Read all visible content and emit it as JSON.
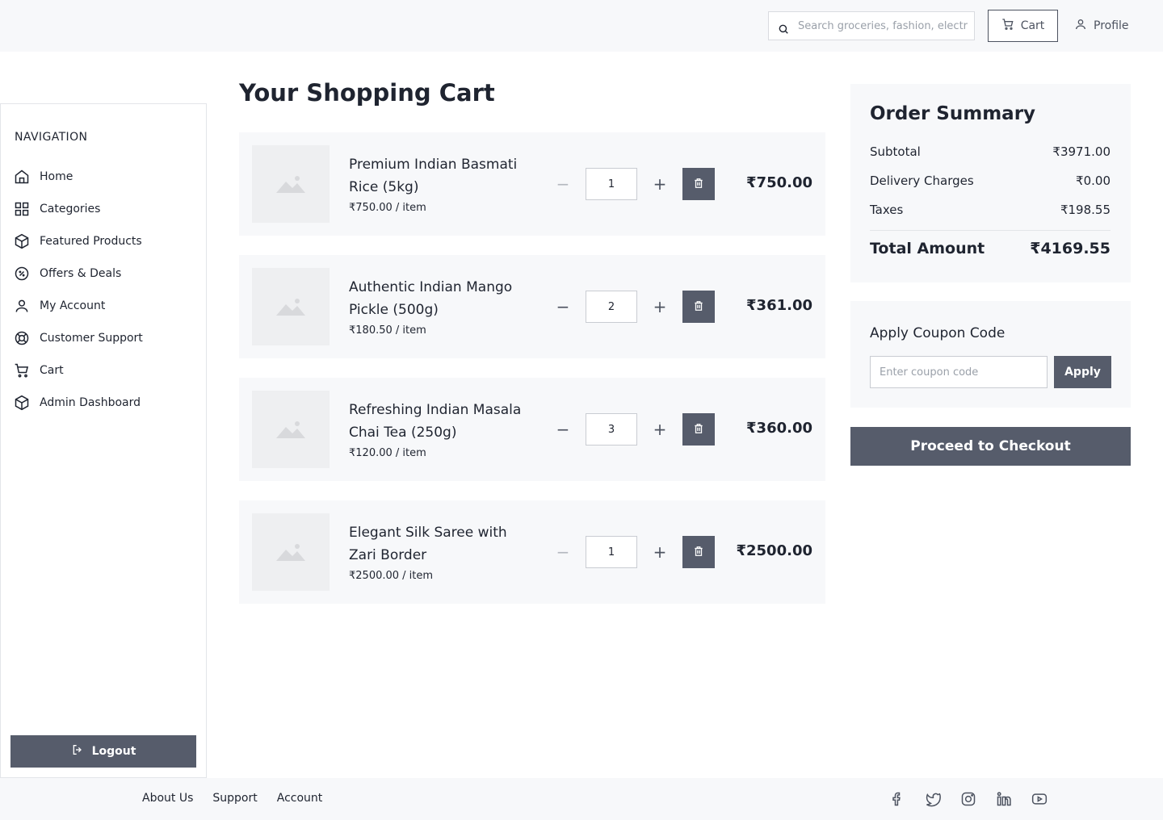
{
  "header": {
    "search_placeholder": "Search groceries, fashion, electronics...",
    "cart_label": "Cart",
    "profile_label": "Profile"
  },
  "sidebar": {
    "heading": "NAVIGATION",
    "items": [
      {
        "label": "Home",
        "icon": "home-icon"
      },
      {
        "label": "Categories",
        "icon": "grid-icon"
      },
      {
        "label": "Featured Products",
        "icon": "box-icon"
      },
      {
        "label": "Offers & Deals",
        "icon": "percent-icon"
      },
      {
        "label": "My Account",
        "icon": "user-icon"
      },
      {
        "label": "Customer Support",
        "icon": "lifebuoy-icon"
      },
      {
        "label": "Cart",
        "icon": "cart-icon"
      },
      {
        "label": "Admin Dashboard",
        "icon": "box-icon"
      }
    ],
    "logout_label": "Logout"
  },
  "main": {
    "title": "Your Shopping Cart",
    "items": [
      {
        "name": "Premium Indian Basmati Rice (5kg)",
        "unit_price": "₹750.00 / item",
        "quantity": "1",
        "total": "₹750.00",
        "minus_disabled": true
      },
      {
        "name": "Authentic Indian Mango Pickle (500g)",
        "unit_price": "₹180.50 / item",
        "quantity": "2",
        "total": "₹361.00",
        "minus_disabled": false
      },
      {
        "name": "Refreshing Indian Masala Chai Tea (250g)",
        "unit_price": "₹120.00 / item",
        "quantity": "3",
        "total": "₹360.00",
        "minus_disabled": false
      },
      {
        "name": "Elegant Silk Saree with Zari Border",
        "unit_price": "₹2500.00 / item",
        "quantity": "1",
        "total": "₹2500.00",
        "minus_disabled": true
      }
    ]
  },
  "summary": {
    "title": "Order Summary",
    "subtotal_label": "Subtotal",
    "subtotal_value": "₹3971.00",
    "delivery_label": "Delivery Charges",
    "delivery_value": "₹0.00",
    "taxes_label": "Taxes",
    "taxes_value": "₹198.55",
    "total_label": "Total Amount",
    "total_value": "₹4169.55"
  },
  "coupon": {
    "title": "Apply Coupon Code",
    "placeholder": "Enter coupon code",
    "apply_label": "Apply"
  },
  "checkout_label": "Proceed to Checkout",
  "footer": {
    "links": [
      "About Us",
      "Support",
      "Account"
    ],
    "social": [
      "facebook-icon",
      "twitter-icon",
      "instagram-icon",
      "linkedin-icon",
      "youtube-icon"
    ]
  },
  "colors": {
    "accent": "#565c6b",
    "panel_bg": "#f7f8fa",
    "text": "#1f2430"
  }
}
